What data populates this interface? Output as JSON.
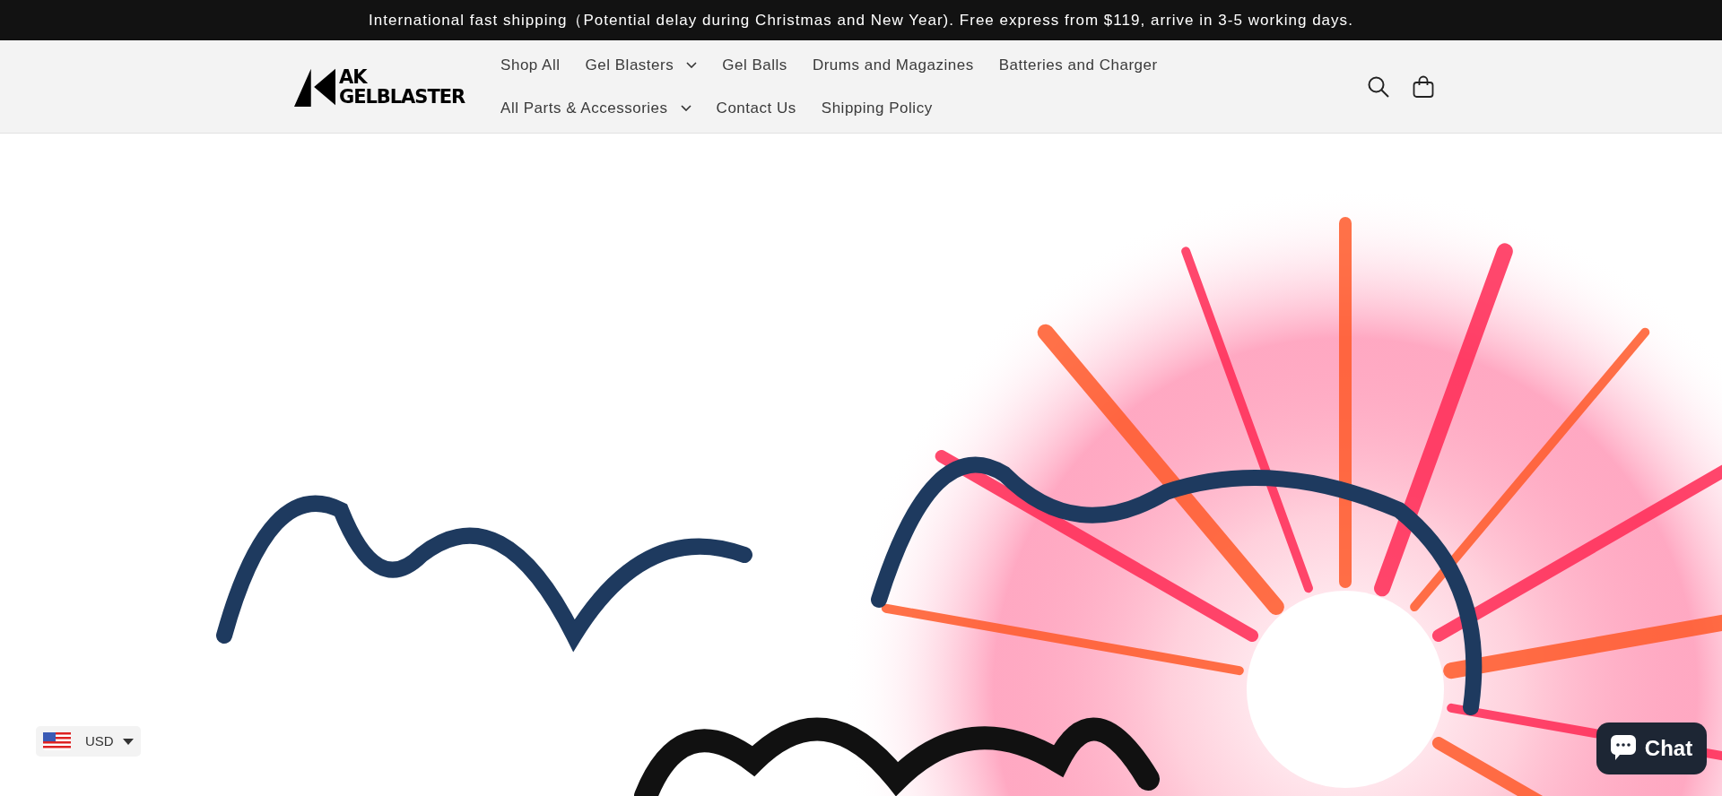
{
  "announcement": "International fast shipping（Potential delay during Christmas and New Year). Free express from $119, arrive in 3-5 working days.",
  "logo": {
    "line_1": "AK",
    "line_2": "GELBLASTER"
  },
  "nav": {
    "links": [
      {
        "label": "Shop All",
        "dropdown": false
      },
      {
        "label": "Gel Blasters",
        "dropdown": true
      },
      {
        "label": "Gel Balls",
        "dropdown": false
      },
      {
        "label": "Drums and Magazines",
        "dropdown": false
      },
      {
        "label": "Batteries and Charger",
        "dropdown": false
      },
      {
        "label": "All Parts & Accessories",
        "dropdown": true
      },
      {
        "label": "Contact Us",
        "dropdown": false
      },
      {
        "label": "Shipping Policy",
        "dropdown": false
      }
    ]
  },
  "currency": {
    "code": "USD"
  },
  "chat": {
    "label": "Chat"
  }
}
